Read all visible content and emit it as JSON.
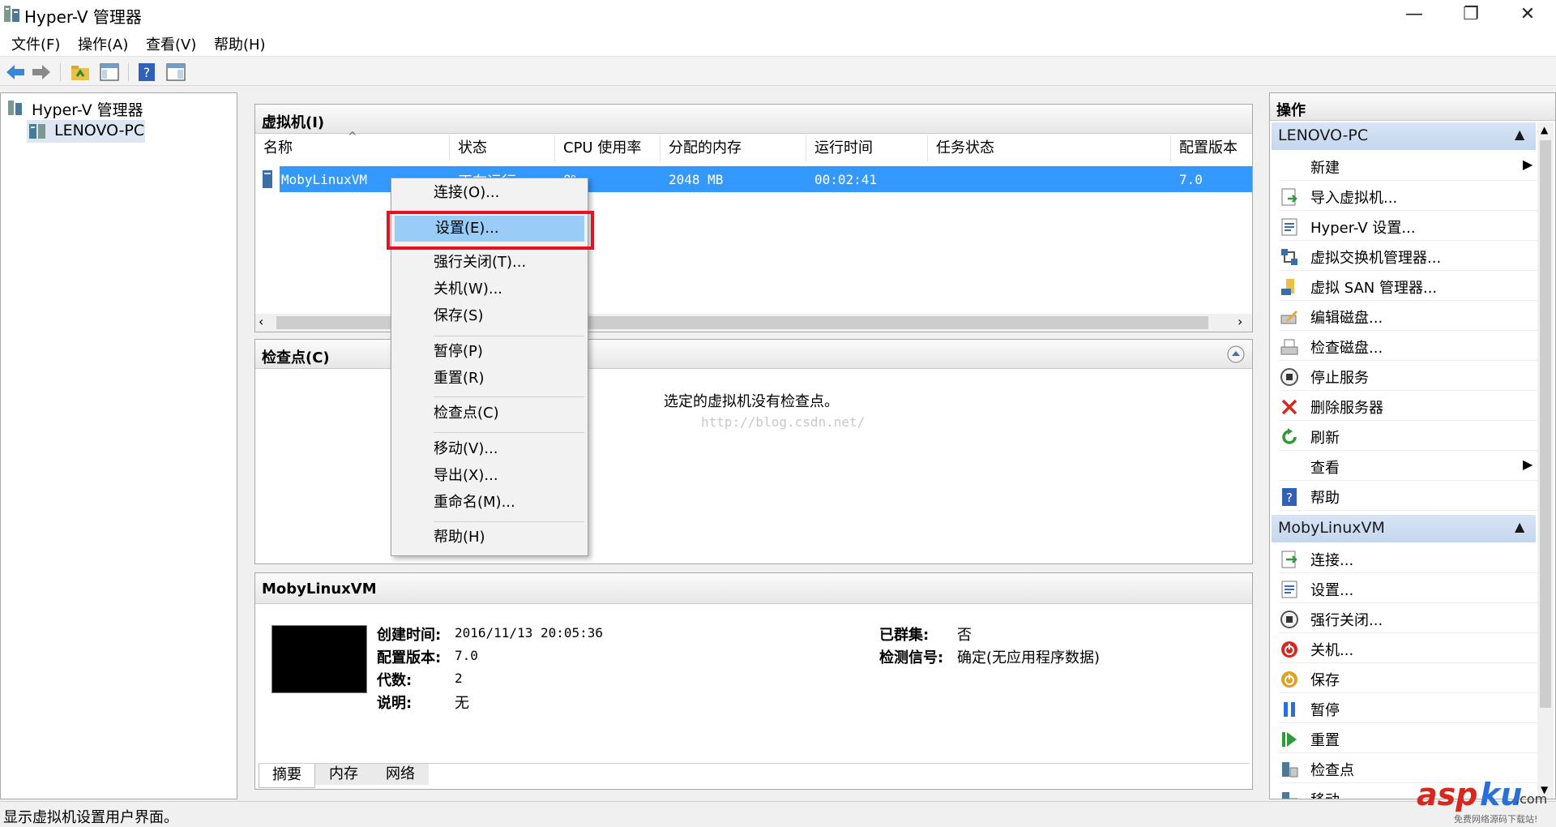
{
  "window": {
    "title": "Hyper-V 管理器",
    "minimize": "—",
    "restore": "❐",
    "close": "✕"
  },
  "menu": [
    "文件(F)",
    "操作(A)",
    "查看(V)",
    "帮助(H)"
  ],
  "tree": {
    "root": "Hyper-V 管理器",
    "child": "LENOVO-PC"
  },
  "vm_panel": {
    "title": "虚拟机(I)",
    "columns": [
      "名称",
      "状态",
      "CPU 使用率",
      "分配的内存",
      "运行时间",
      "任务状态",
      "配置版本"
    ],
    "row": {
      "name": "MobyLinuxVM",
      "state": "正在运行",
      "cpu": "0%",
      "memory": "2048 MB",
      "uptime": "00:02:41",
      "task": "",
      "version": "7.0"
    }
  },
  "checkpoint_panel": {
    "title": "检查点(C)",
    "empty_text": "选定的虚拟机没有检查点。",
    "watermark": "http://blog.csdn.net/"
  },
  "details_panel": {
    "title": "MobyLinuxVM",
    "left": [
      {
        "label": "创建时间:",
        "value": "2016/11/13 20:05:36"
      },
      {
        "label": "配置版本:",
        "value": "7.0"
      },
      {
        "label": "代数:",
        "value": "2"
      },
      {
        "label": "说明:",
        "value": "无"
      }
    ],
    "right": [
      {
        "label": "已群集:",
        "value": "否"
      },
      {
        "label": "检测信号:",
        "value": "确定(无应用程序数据)"
      }
    ],
    "tabs": [
      "摘要",
      "内存",
      "网络"
    ]
  },
  "context_menu": {
    "items": [
      "连接(O)...",
      "设置(E)...",
      "强行关闭(T)...",
      "关机(W)...",
      "保存(S)",
      "暂停(P)",
      "重置(R)",
      "检查点(C)",
      "移动(V)...",
      "导出(X)...",
      "重命名(M)...",
      "帮助(H)"
    ],
    "highlighted": "设置(E)..."
  },
  "actions": {
    "header": "操作",
    "section1": {
      "title": "LENOVO-PC",
      "items": [
        {
          "label": "新建",
          "icon": "new-icon"
        },
        {
          "label": "导入虚拟机...",
          "icon": "import-icon"
        },
        {
          "label": "Hyper-V 设置...",
          "icon": "settings-icon"
        },
        {
          "label": "虚拟交换机管理器...",
          "icon": "switch-icon"
        },
        {
          "label": "虚拟 SAN 管理器...",
          "icon": "san-icon"
        },
        {
          "label": "编辑磁盘...",
          "icon": "edit-disk-icon"
        },
        {
          "label": "检查磁盘...",
          "icon": "inspect-disk-icon"
        },
        {
          "label": "停止服务",
          "icon": "stop-icon"
        },
        {
          "label": "删除服务器",
          "icon": "delete-icon"
        },
        {
          "label": "刷新",
          "icon": "refresh-icon"
        },
        {
          "label": "查看",
          "icon": "view-icon"
        },
        {
          "label": "帮助",
          "icon": "help-icon"
        }
      ]
    },
    "section2": {
      "title": "MobyLinuxVM",
      "items": [
        {
          "label": "连接...",
          "icon": "connect-icon"
        },
        {
          "label": "设置...",
          "icon": "settings-icon"
        },
        {
          "label": "强行关闭...",
          "icon": "turnoff-icon"
        },
        {
          "label": "关机...",
          "icon": "shutdown-icon"
        },
        {
          "label": "保存",
          "icon": "save-icon"
        },
        {
          "label": "暂停",
          "icon": "pause-icon"
        },
        {
          "label": "重置",
          "icon": "reset-icon"
        },
        {
          "label": "检查点",
          "icon": "checkpoint-icon"
        },
        {
          "label": "移动...",
          "icon": "move-icon"
        }
      ]
    }
  },
  "status_text": "显示虚拟机设置用户界面。",
  "watermark_brand": {
    "a": "asp",
    "b": "ku",
    "c": ".com",
    "sub": "免费网络源码下载站!"
  },
  "colors": {
    "selection": "#3399ff",
    "highlight": "#99ccf7",
    "redbox": "#e81123"
  }
}
